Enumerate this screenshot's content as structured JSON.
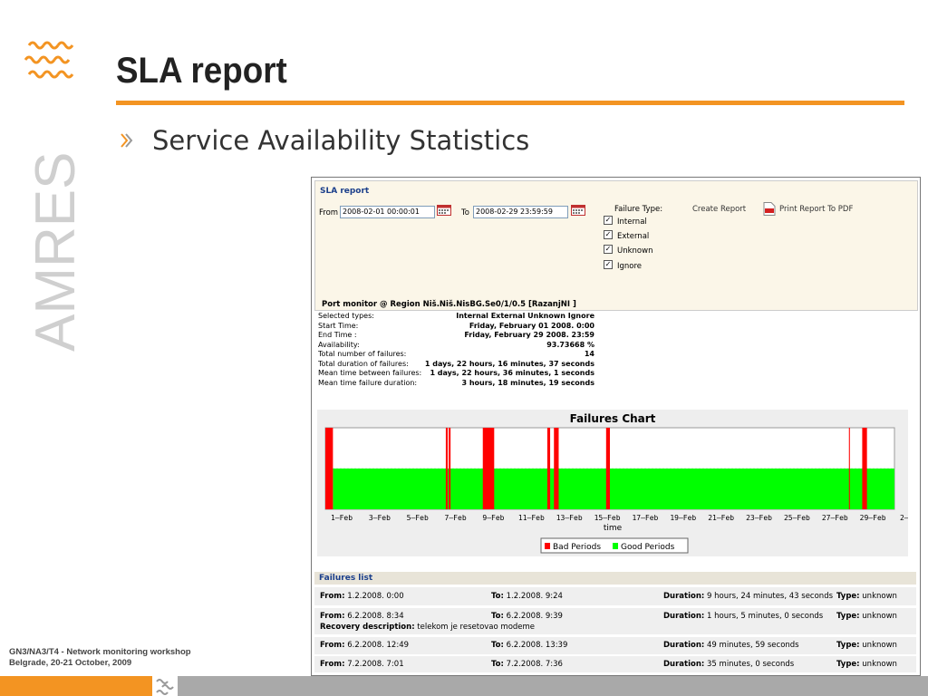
{
  "slide": {
    "title": "SLA report",
    "bullet": "Service Availability Statistics",
    "footer_line1": "GN3/NA3/T4 - Network monitoring workshop",
    "footer_line2": "Belgrade, 20-21 October, 2009",
    "vertical_brand": "AMRES",
    "accent_color": "#f39422"
  },
  "app": {
    "panel_title": "SLA report",
    "from_label": "From",
    "from_value": "2008-02-01 00:00:01",
    "to_label": "To",
    "to_value": "2008-02-29 23:59:59",
    "failure_type_label": "Failure Type:",
    "failure_types": [
      "Internal",
      "External",
      "Unknown",
      "Ignore"
    ],
    "create_report": "Create Report",
    "print_report": "Print Report To PDF",
    "monitor_title": "Port monitor @ Region Niš.Niš.NisBG.Se0/1/0.5 [RazanjNI ]",
    "stats": [
      {
        "k": "Selected types:",
        "v": "Internal External Unknown Ignore"
      },
      {
        "k": "Start Time:",
        "v": "Friday, February 01 2008. 0:00"
      },
      {
        "k": "End Time :",
        "v": "Friday, February 29 2008. 23:59"
      },
      {
        "k": "Availability:",
        "v": "93.73668 %"
      },
      {
        "k": "Total number of failures:",
        "v": "14"
      },
      {
        "k": "Total duration of failures:",
        "v": "1 days, 22 hours, 16 minutes, 37 seconds"
      },
      {
        "k": "Mean time between failures:",
        "v": "1 days, 22 hours, 36 minutes, 1 seconds"
      },
      {
        "k": "Mean time failure duration:",
        "v": "3 hours, 18 minutes, 19 seconds"
      }
    ],
    "failures_list_title": "Failures list",
    "failures": [
      {
        "from": "1.2.2008. 0:00",
        "to": "1.2.2008. 9:24",
        "duration": "9 hours, 24 minutes, 43 seconds",
        "type": "unknown",
        "recovery": ""
      },
      {
        "from": "6.2.2008. 8:34",
        "to": "6.2.2008. 9:39",
        "duration": "1 hours, 5 minutes, 0 seconds",
        "type": "unknown",
        "recovery": "telekom je resetovao modeme"
      },
      {
        "from": "6.2.2008. 12:49",
        "to": "6.2.2008. 13:39",
        "duration": "49 minutes, 59 seconds",
        "type": "unknown",
        "recovery": ""
      },
      {
        "from": "7.2.2008. 7:01",
        "to": "7.2.2008. 7:36",
        "duration": "35 minutes, 0 seconds",
        "type": "unknown",
        "recovery": ""
      }
    ],
    "labels": {
      "from": "From:",
      "to": "To:",
      "duration": "Duration:",
      "type": "Type:",
      "recovery": "Recovery description:"
    }
  },
  "chart_data": {
    "type": "bar",
    "title": "Failures Chart",
    "xlabel": "time",
    "ylabel": "",
    "x_tick_labels": [
      "1–Feb",
      "3–Feb",
      "5–Feb",
      "7–Feb",
      "9–Feb",
      "11–Feb",
      "13–Feb",
      "15–Feb",
      "17–Feb",
      "19–Feb",
      "21–Feb",
      "23–Feb",
      "25–Feb",
      "27–Feb",
      "29–Feb",
      "2–Mar"
    ],
    "x_range_days": [
      0,
      30
    ],
    "legend": [
      "Bad Periods",
      "Good Periods"
    ],
    "legend_placement": "bottom-center",
    "colors": {
      "bad": "#ff0000",
      "good": "#00ff00"
    },
    "good_period": [
      0.4,
      30
    ],
    "bad_periods": [
      [
        0,
        0.4
      ],
      [
        6.35,
        6.45
      ],
      [
        6.5,
        6.6
      ],
      [
        8.3,
        8.9
      ],
      [
        11.7,
        11.85
      ],
      [
        12.05,
        12.3
      ],
      [
        14.8,
        15.0
      ],
      [
        27.6,
        27.65
      ],
      [
        28.3,
        28.55
      ]
    ]
  }
}
